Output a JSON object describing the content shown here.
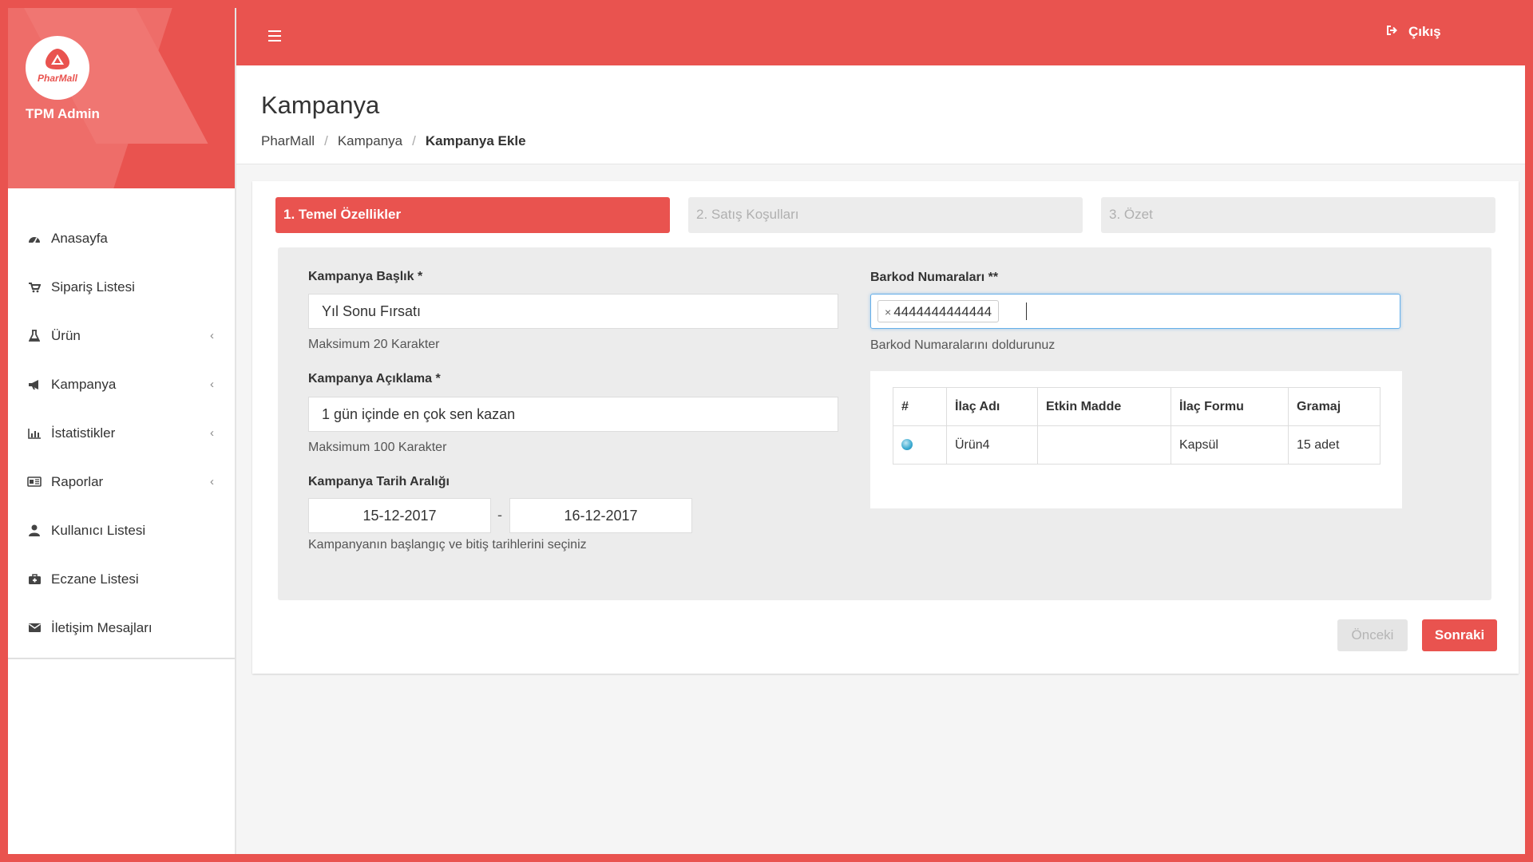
{
  "brand": {
    "logo_text": "PharMall",
    "name": "TPM Admin"
  },
  "topbar": {
    "logout_label": "Çıkış"
  },
  "sidebar": {
    "items": [
      {
        "label": "Anasayfa",
        "icon": "dashboard-icon",
        "has_submenu": false
      },
      {
        "label": "Sipariş Listesi",
        "icon": "cart-icon",
        "has_submenu": false
      },
      {
        "label": "Ürün",
        "icon": "flask-icon",
        "has_submenu": true
      },
      {
        "label": "Kampanya",
        "icon": "bullhorn-icon",
        "has_submenu": true
      },
      {
        "label": "İstatistikler",
        "icon": "bar-chart-icon",
        "has_submenu": true
      },
      {
        "label": "Raporlar",
        "icon": "report-icon",
        "has_submenu": true
      },
      {
        "label": "Kullanıcı Listesi",
        "icon": "user-icon",
        "has_submenu": false
      },
      {
        "label": "Eczane Listesi",
        "icon": "medkit-icon",
        "has_submenu": false
      },
      {
        "label": "İletişim Mesajları",
        "icon": "envelope-icon",
        "has_submenu": false
      }
    ]
  },
  "page": {
    "title": "Kampanya",
    "breadcrumb": [
      "PharMall",
      "Kampanya",
      "Kampanya Ekle"
    ]
  },
  "wizard": {
    "steps": [
      {
        "label": "1. Temel Özellikler",
        "active": true
      },
      {
        "label": "2. Satış Koşulları",
        "active": false
      },
      {
        "label": "3. Özet",
        "active": false
      }
    ]
  },
  "form": {
    "title_label": "Kampanya Başlık *",
    "title_value": "Yıl Sonu Fırsatı",
    "title_help": "Maksimum 20 Karakter",
    "desc_label": "Kampanya Açıklama *",
    "desc_value": "1 gün içinde en çok sen kazan",
    "desc_help": "Maksimum 100 Karakter",
    "date_label": "Kampanya Tarih Aralığı",
    "date_start": "15-12-2017",
    "date_sep": "-",
    "date_end": "16-12-2017",
    "date_help": "Kampanyanın başlangıç ve bitiş tarihlerini seçiniz",
    "barcode_label": "Barkod Numaraları **",
    "barcode_tag_remove": "×",
    "barcode_tag": "4444444444444",
    "barcode_help": "Barkod Numaralarını doldurunuz"
  },
  "products_table": {
    "columns": [
      "#",
      "İlaç Adı",
      "Etkin Madde",
      "İlaç Formu",
      "Gramaj"
    ],
    "rows": [
      {
        "name": "Ürün4",
        "active_ingredient": "",
        "form": "Kapsül",
        "amount": "15 adet"
      }
    ]
  },
  "actions": {
    "prev_label": "Önceki",
    "next_label": "Sonraki"
  },
  "colors": {
    "accent": "#e9534f",
    "panel": "#ececec",
    "focus": "#66afe9"
  }
}
